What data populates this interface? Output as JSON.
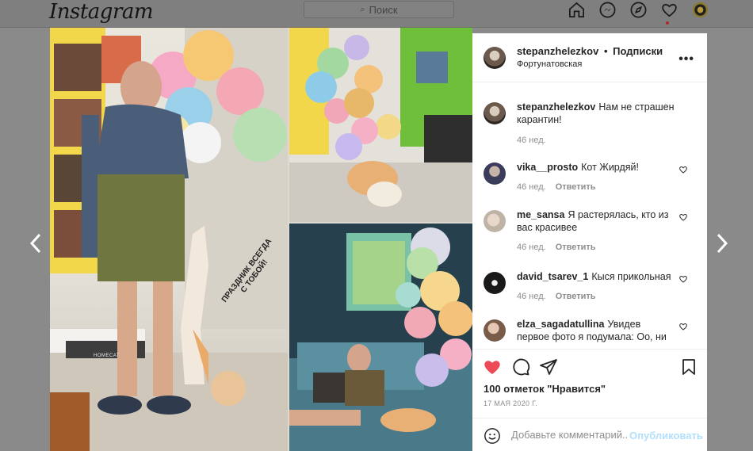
{
  "app": {
    "logo": "Instagram"
  },
  "nav": {
    "search_placeholder": "Поиск",
    "icons": [
      "home-icon",
      "messenger-icon",
      "explore-icon",
      "heart-icon",
      "profile-avatar"
    ]
  },
  "photo": {
    "sticker_line1": "ПРАЗДНИК ВСЕГДА",
    "sticker_line2": "С ТОБОЙ!",
    "mat_label": "HOMECAT"
  },
  "post": {
    "username": "stepanzhelezkov",
    "dot": "•",
    "follow_label": "Подписки",
    "location": "Фортунатовская",
    "more": "•••",
    "caption": {
      "user": "stepanzhelezkov",
      "text": "Нам не страшен карантин!",
      "time": "46 нед."
    },
    "comments": [
      {
        "user": "vika__prosto",
        "text": "Кот Жирдяй!",
        "time": "46 нед.",
        "reply": "Ответить"
      },
      {
        "user": "me_sansa",
        "text": "Я растерялась, кто из вас красивее",
        "time": "46 нед.",
        "reply": "Ответить"
      },
      {
        "user": "david_tsarev_1",
        "text": "Кыся прикольная",
        "time": "46 нед.",
        "reply": "Ответить"
      },
      {
        "user": "elza_sagadatullina",
        "text": "Увидев первое фото я подумала: Оо, ни",
        "time": "",
        "reply": ""
      }
    ],
    "likes": "100 отметок \"Нравится\"",
    "date": "17 МАЯ 2020 Г.",
    "add_comment_placeholder": "Добавьте комментарий...",
    "publish": "Опубликовать"
  },
  "colors": {
    "like_red": "#ed4956",
    "link_blue": "#b2dffc",
    "meta_gray": "#8e8e8e"
  }
}
